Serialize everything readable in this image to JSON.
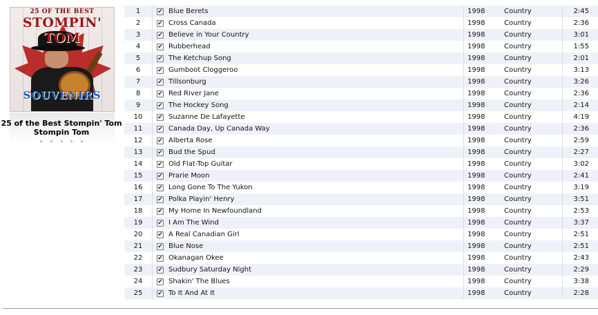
{
  "album": {
    "title": "25 of the Best Stompin' Tom",
    "artist": "Stompin Tom",
    "cover": {
      "top_text": "25 OF THE BEST",
      "big_text": "STOMPIN' TOM",
      "bottom_text": "SOUVENIRS"
    }
  },
  "tracks": [
    {
      "num": "1",
      "checked": true,
      "name": "Blue Berets",
      "year": "1998",
      "genre": "Country",
      "time": "2:45"
    },
    {
      "num": "2",
      "checked": true,
      "name": "Cross Canada",
      "year": "1998",
      "genre": "Country",
      "time": "2:36"
    },
    {
      "num": "3",
      "checked": true,
      "name": "Believe in Your Country",
      "year": "1998",
      "genre": "Country",
      "time": "3:01"
    },
    {
      "num": "4",
      "checked": true,
      "name": "Rubberhead",
      "year": "1998",
      "genre": "Country",
      "time": "1:55"
    },
    {
      "num": "5",
      "checked": true,
      "name": "The Ketchup Song",
      "year": "1998",
      "genre": "Country",
      "time": "2:01"
    },
    {
      "num": "6",
      "checked": true,
      "name": "Gumboot Cloggeroo",
      "year": "1998",
      "genre": "Country",
      "time": "3:13"
    },
    {
      "num": "7",
      "checked": true,
      "name": "Tillsonburg",
      "year": "1998",
      "genre": "Country",
      "time": "3:26"
    },
    {
      "num": "8",
      "checked": true,
      "name": "Red River Jane",
      "year": "1998",
      "genre": "Country",
      "time": "2:36"
    },
    {
      "num": "9",
      "checked": true,
      "name": "The Hockey Song",
      "year": "1998",
      "genre": "Country",
      "time": "2:14"
    },
    {
      "num": "10",
      "checked": true,
      "name": "Suzanne De Lafayette",
      "year": "1998",
      "genre": "Country",
      "time": "4:19"
    },
    {
      "num": "11",
      "checked": true,
      "name": "Canada Day, Up Canada Way",
      "year": "1998",
      "genre": "Country",
      "time": "2:36"
    },
    {
      "num": "12",
      "checked": true,
      "name": "Alberta Rose",
      "year": "1998",
      "genre": "Country",
      "time": "2:59"
    },
    {
      "num": "13",
      "checked": true,
      "name": "Bud the Spud",
      "year": "1998",
      "genre": "Country",
      "time": "2:27"
    },
    {
      "num": "14",
      "checked": true,
      "name": "Old Flat-Top Guitar",
      "year": "1998",
      "genre": "Country",
      "time": "3:02"
    },
    {
      "num": "15",
      "checked": true,
      "name": "Prarie Moon",
      "year": "1998",
      "genre": "Country",
      "time": "2:41"
    },
    {
      "num": "16",
      "checked": true,
      "name": "Long Gone To The Yukon",
      "year": "1998",
      "genre": "Country",
      "time": "3:19"
    },
    {
      "num": "17",
      "checked": true,
      "name": "Polka Playin' Henry",
      "year": "1998",
      "genre": "Country",
      "time": "3:51"
    },
    {
      "num": "18",
      "checked": true,
      "name": "My Home In Newfoundland",
      "year": "1998",
      "genre": "Country",
      "time": "2:53"
    },
    {
      "num": "19",
      "checked": true,
      "name": "I Am The Wind",
      "year": "1998",
      "genre": "Country",
      "time": "3:37"
    },
    {
      "num": "20",
      "checked": true,
      "name": "A Real Canadian Girl",
      "year": "1998",
      "genre": "Country",
      "time": "2:51"
    },
    {
      "num": "21",
      "checked": true,
      "name": "Blue Nose",
      "year": "1998",
      "genre": "Country",
      "time": "2:51"
    },
    {
      "num": "22",
      "checked": true,
      "name": "Okanagan Okee",
      "year": "1998",
      "genre": "Country",
      "time": "2:43"
    },
    {
      "num": "23",
      "checked": true,
      "name": "Sudbury Saturday Night",
      "year": "1998",
      "genre": "Country",
      "time": "2:29"
    },
    {
      "num": "24",
      "checked": true,
      "name": "Shakin' The Blues",
      "year": "1998",
      "genre": "Country",
      "time": "3:38"
    },
    {
      "num": "25",
      "checked": true,
      "name": "To It And At It",
      "year": "1998",
      "genre": "Country",
      "time": "2:28"
    }
  ],
  "colors": {
    "row_alt": "#eef2f8",
    "separator": "#d9dde4"
  }
}
